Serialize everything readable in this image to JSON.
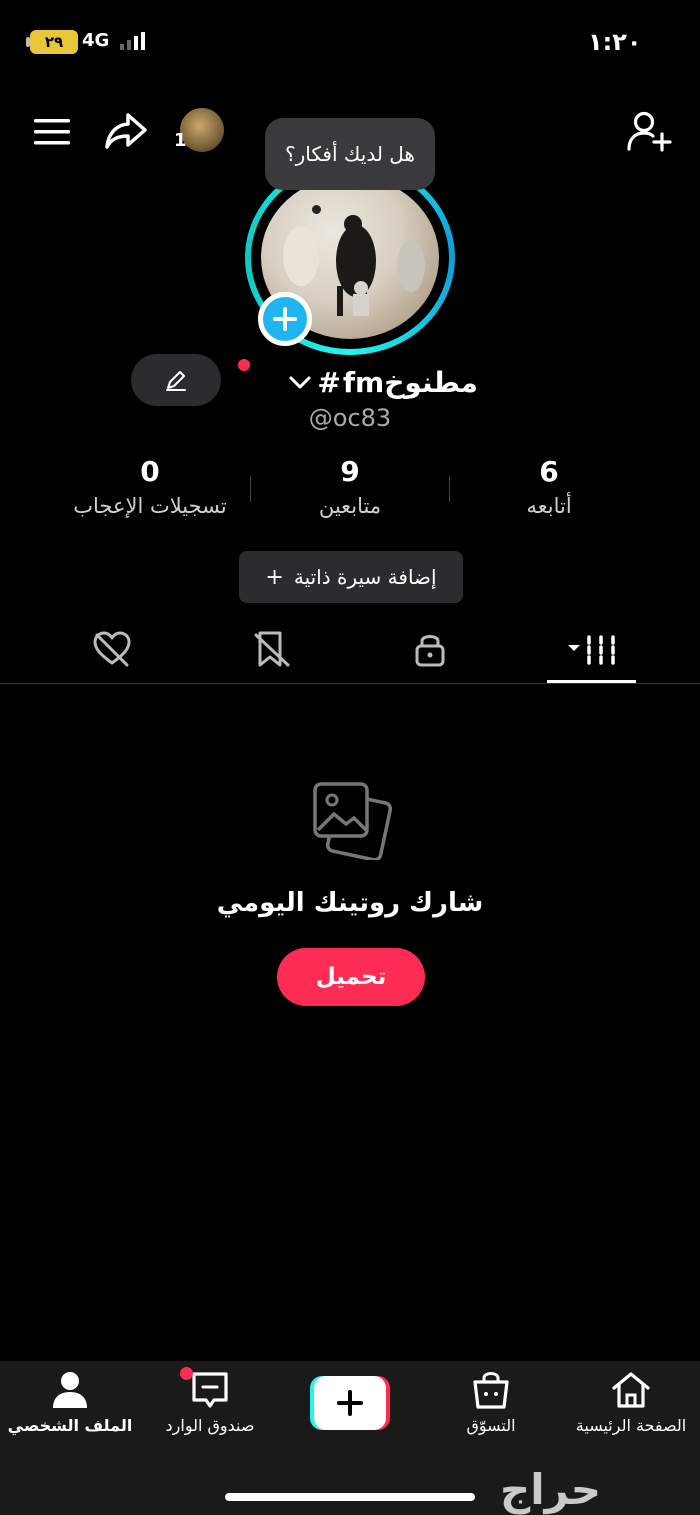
{
  "status_bar": {
    "time": "١:٢٠",
    "network": "4G",
    "battery": "٢٩"
  },
  "top_bar": {
    "friends_count": "1"
  },
  "tooltip": {
    "text": "هل لديك أفكار؟"
  },
  "profile": {
    "name": "مطنوخfm",
    "name_symbol": "#",
    "handle": "@oc83"
  },
  "stats": [
    {
      "value": "6",
      "label": "أتابعه"
    },
    {
      "value": "9",
      "label": "متابعين"
    },
    {
      "value": "0",
      "label": "تسجيلات الإعجاب"
    }
  ],
  "bio_button": {
    "label": "إضافة سيرة ذاتية",
    "prefix": "+"
  },
  "tabs": [
    "videos-grid",
    "private-lock",
    "reposts",
    "liked"
  ],
  "empty_state": {
    "title": "شارك روتينك اليومي",
    "button": "تحميل"
  },
  "bottom_nav": {
    "home": "الصفحة الرئيسية",
    "shop": "التسوّق",
    "create": "+",
    "inbox": "صندوق الوارد",
    "profile": "الملف الشخصي"
  },
  "watermark": "حراج",
  "colors": {
    "accent": "#fe2c55",
    "ring": "#25f4ee",
    "badge": "#20b5f0"
  }
}
